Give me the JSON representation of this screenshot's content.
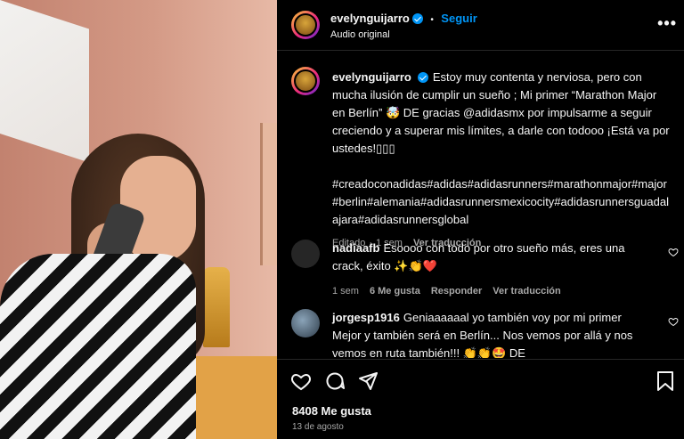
{
  "post": {
    "username": "evelynguijarro",
    "follow_label": "Seguir",
    "audio": "Audio original",
    "more": "•••"
  },
  "caption": {
    "username": "evelynguijarro",
    "text": "Estoy muy contenta y nerviosa, pero con mucha ilusión de cumplir un sueño ; Mi primer “Marathon Major en Berlín” 🤯 DE gracias @adidasmx por impulsarme a seguir creciendo y a superar mis límites, a darle con todooo ¡Está va por ustedes!▯▯▯",
    "hashtags": "#creadoconadidas#adidas#adidasrunners#marathonmajor#major#berlin#alemania#adidasrunnersmexicocity#adidasrunnersguadalajara#adidasrunnersglobal",
    "edited": "Editado",
    "time": "1 sem",
    "translate": "Ver traducción"
  },
  "comments": [
    {
      "username": "nadiaafb",
      "text": "Esoooo con todo por otro sueño más, eres una crack, éxito ✨👏❤️",
      "time": "1 sem",
      "likes": "6 Me gusta",
      "reply": "Responder",
      "translate": "Ver traducción",
      "avatar_color": "#262626"
    },
    {
      "username": "jorgesp1916",
      "text": "Geniaaaaaal yo también voy por mi primer Mejor y también será en Berlín... Nos vemos por allá y nos vemos en ruta también!!! 👏👏🤩 DE",
      "avatar_color": "#3a4a5a"
    }
  ],
  "footer": {
    "likes": "8408 Me gusta",
    "date": "13 de agosto"
  },
  "icons": [
    "heart-icon",
    "comment-icon",
    "share-icon",
    "bookmark-icon",
    "more-options-icon",
    "verified-icon"
  ]
}
